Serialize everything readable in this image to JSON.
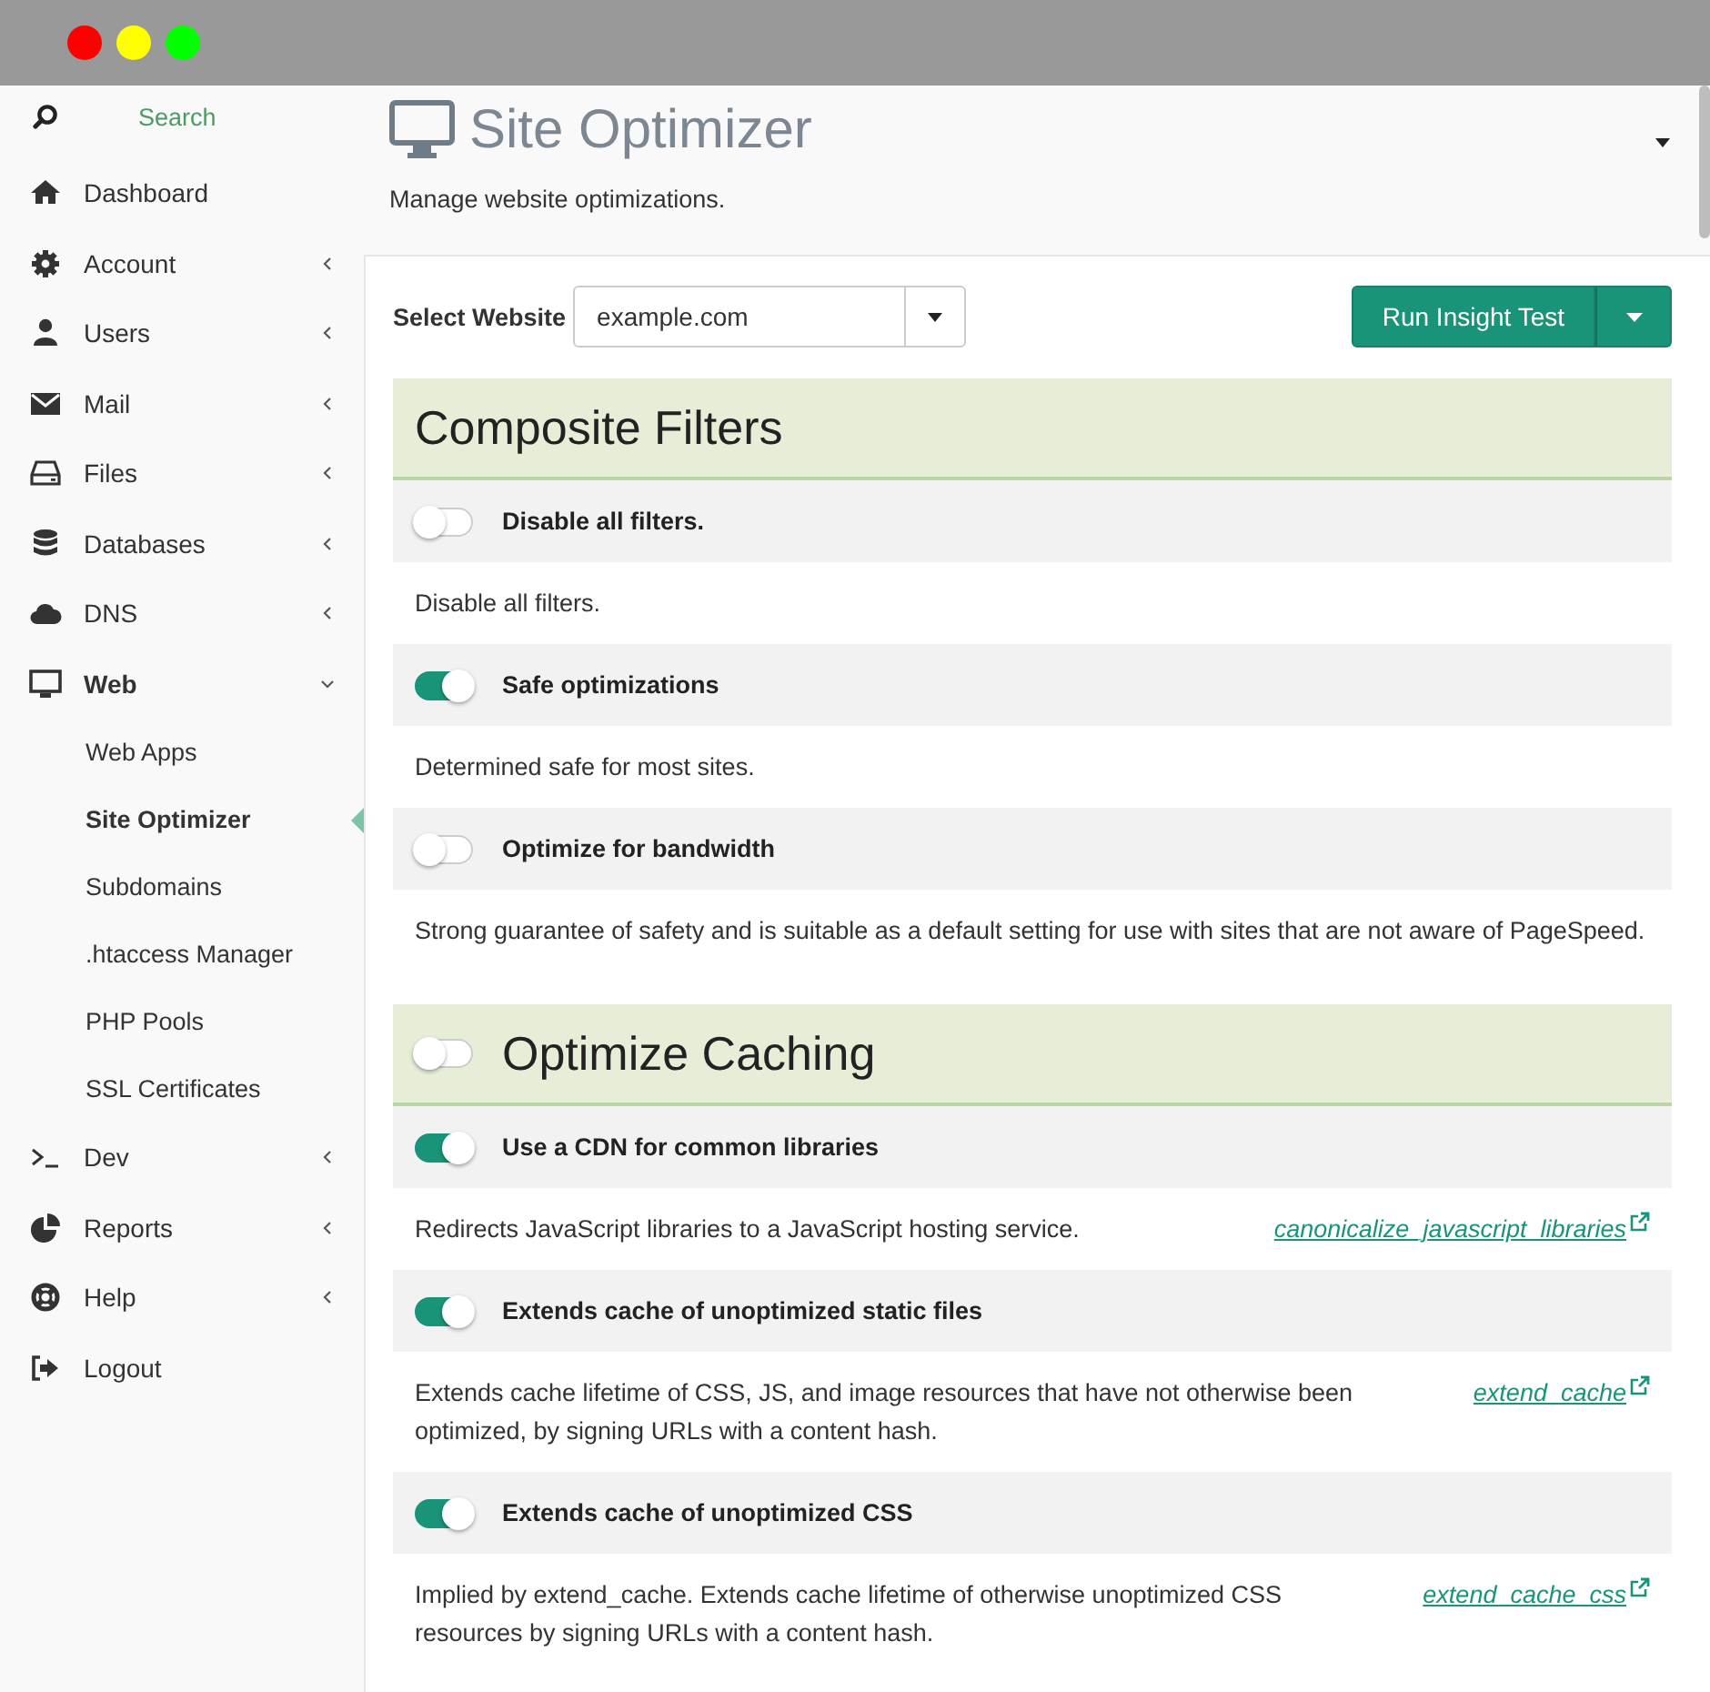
{
  "window": {
    "controls": [
      {
        "color": "#ff0000"
      },
      {
        "color": "#ffff00"
      },
      {
        "color": "#00ff00"
      }
    ]
  },
  "sidebar": {
    "search": {
      "placeholder": "Search"
    },
    "items": [
      {
        "label": "Dashboard",
        "expandable": false,
        "expanded": false
      },
      {
        "label": "Account",
        "expandable": true,
        "expanded": false
      },
      {
        "label": "Users",
        "expandable": true,
        "expanded": false
      },
      {
        "label": "Mail",
        "expandable": true,
        "expanded": false
      },
      {
        "label": "Files",
        "expandable": true,
        "expanded": false
      },
      {
        "label": "Databases",
        "expandable": true,
        "expanded": false
      },
      {
        "label": "DNS",
        "expandable": true,
        "expanded": false
      },
      {
        "label": "Web",
        "expandable": true,
        "expanded": true,
        "children": [
          {
            "label": "Web Apps",
            "selected": false
          },
          {
            "label": "Site Optimizer",
            "selected": true
          },
          {
            "label": "Subdomains",
            "selected": false
          },
          {
            "label": ".htaccess Manager",
            "selected": false
          },
          {
            "label": "PHP Pools",
            "selected": false
          },
          {
            "label": "SSL Certificates",
            "selected": false
          }
        ]
      },
      {
        "label": "Dev",
        "expandable": true,
        "expanded": false
      },
      {
        "label": "Reports",
        "expandable": true,
        "expanded": false
      },
      {
        "label": "Help",
        "expandable": true,
        "expanded": false
      },
      {
        "label": "Logout",
        "expandable": false,
        "expanded": false
      }
    ]
  },
  "header": {
    "title": "Site Optimizer",
    "subtitle": "Manage website optimizations."
  },
  "toolbar": {
    "select_label": "Select Website",
    "website": {
      "value": "example.com"
    },
    "run_button": "Run Insight Test"
  },
  "sections": [
    {
      "title": "Composite Filters",
      "rows": [
        {
          "label": "Disable all filters.",
          "on": false,
          "description": "Disable all filters."
        },
        {
          "label": "Safe optimizations",
          "on": true,
          "description": "Determined safe for most sites."
        },
        {
          "label": "Optimize for bandwidth",
          "on": false,
          "description": "Strong guarantee of safety and is suitable as a default setting for use with sites that are not aware of PageSpeed."
        }
      ]
    },
    {
      "title": "Optimize Caching",
      "on": false,
      "rows": [
        {
          "label": "Use a CDN for common libraries",
          "on": true,
          "description": "Redirects JavaScript libraries to a JavaScript hosting service.",
          "link": "canonicalize_javascript_libraries"
        },
        {
          "label": "Extends cache of unoptimized static files",
          "on": true,
          "description": "Extends cache lifetime of CSS, JS, and image resources that have not otherwise been optimized, by signing URLs with a content hash.",
          "link": "extend_cache"
        },
        {
          "label": "Extends cache of unoptimized CSS",
          "on": true,
          "description": "Implied by extend_cache. Extends cache lifetime of otherwise unoptimized CSS resources by signing URLs with a content hash.",
          "link": "extend_cache_css"
        }
      ]
    }
  ]
}
